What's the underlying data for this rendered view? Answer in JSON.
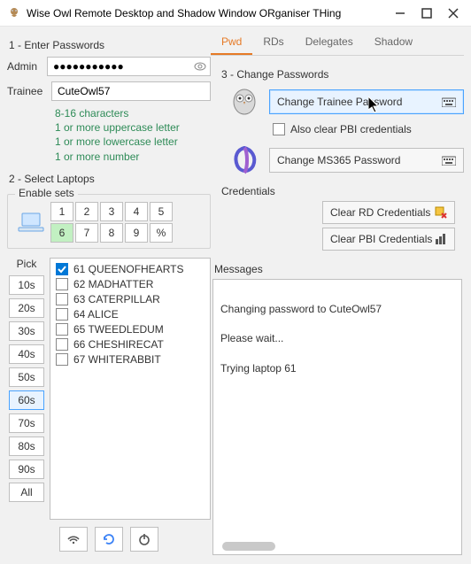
{
  "title": "Wise Owl Remote Desktop and Shadow Window ORganiser THing",
  "left": {
    "sec1_title": "1 - Enter Passwords",
    "admin_label": "Admin",
    "admin_value_masked": "●●●●●●●●●●●",
    "trainee_label": "Trainee",
    "trainee_value": "CuteOwl57",
    "rules": {
      "r1": "8-16 characters",
      "r2": "1 or more uppercase letter",
      "r3": "1 or more lowercase letter",
      "r4": "1 or more number"
    },
    "sec2_title": "2 - Select Laptops",
    "enable_legend": "Enable sets",
    "nums": {
      "b1": "1",
      "b2": "2",
      "b3": "3",
      "b4": "4",
      "b5": "5",
      "b6": "6",
      "b7": "7",
      "b8": "8",
      "b9": "9",
      "bpct": "%"
    },
    "pick_label": "Pick",
    "times": {
      "t10": "10s",
      "t20": "20s",
      "t30": "30s",
      "t40": "40s",
      "t50": "50s",
      "t60": "60s",
      "t70": "70s",
      "t80": "80s",
      "t90": "90s",
      "tall": "All"
    },
    "items": {
      "i0": "61 QUEENOFHEARTS",
      "i1": "62 MADHATTER",
      "i2": "63 CATERPILLAR",
      "i3": "64 ALICE",
      "i4": "65 TWEEDLEDUM",
      "i5": "66 CHESHIRECAT",
      "i6": "67 WHITERABBIT"
    }
  },
  "right": {
    "tabs": {
      "pwd": "Pwd",
      "rds": "RDs",
      "del": "Delegates",
      "shadow": "Shadow"
    },
    "sec3_title": "3 - Change Passwords",
    "btn_change_trainee": "Change Trainee Password",
    "also_clear": "Also clear PBI credentials",
    "btn_change_ms365": "Change MS365 Password",
    "cred_title": "Credentials",
    "btn_clear_rd": "Clear RD Credentials",
    "btn_clear_pbi": "Clear PBI Credentials",
    "msg_title": "Messages",
    "msg_body": "Changing password to CuteOwl57\n\nPlease wait...\n\nTrying laptop 61"
  }
}
